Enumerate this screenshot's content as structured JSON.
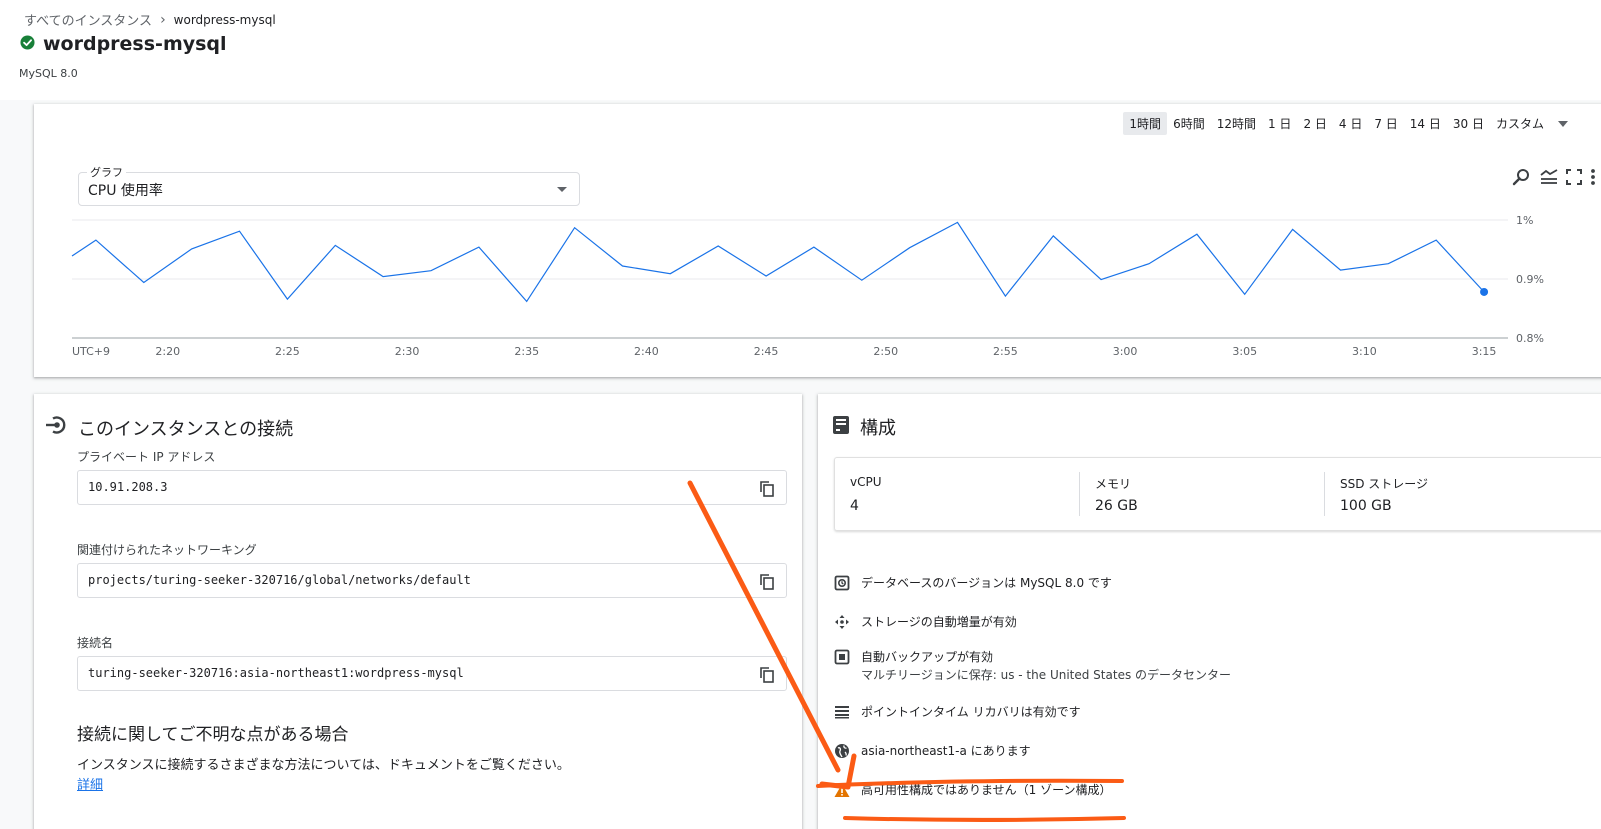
{
  "breadcrumb": {
    "parent": "すべてのインスタンス",
    "separator": "›",
    "current": "wordpress-mysql"
  },
  "instance": {
    "name": "wordpress-mysql",
    "version": "MySQL 8.0",
    "status": "running"
  },
  "timeRange": {
    "options": [
      "1時間",
      "6時間",
      "12時間",
      "1 日",
      "2 日",
      "4 日",
      "7 日",
      "14 日",
      "30 日",
      "カスタム"
    ],
    "selected": "1時間"
  },
  "chartSelector": {
    "label": "グラフ",
    "value": "CPU 使用率"
  },
  "chart_data": {
    "type": "line",
    "timezone": "UTC+9",
    "xticks": [
      "2:20",
      "2:25",
      "2:30",
      "2:35",
      "2:40",
      "2:45",
      "2:50",
      "2:55",
      "3:00",
      "3:05",
      "3:10",
      "3:15"
    ],
    "yticks": [
      "1%",
      "0.9%",
      "0.8%"
    ],
    "ylim": [
      0.8,
      1.0
    ],
    "grid": true,
    "series": [
      {
        "color": "#1a73e8",
        "x": [
          "2:16",
          "2:17",
          "2:19",
          "2:21",
          "2:23",
          "2:25",
          "2:27",
          "2:29",
          "2:31",
          "2:33",
          "2:35",
          "2:37",
          "2:39",
          "2:41",
          "2:43",
          "2:45",
          "2:47",
          "2:49",
          "2:51",
          "2:53",
          "2:55",
          "2:57",
          "2:59",
          "3:01",
          "3:03",
          "3:05",
          "3:07",
          "3:09",
          "3:11",
          "3:13",
          "3:15"
        ],
        "values": [
          0.939,
          0.966,
          0.894,
          0.951,
          0.981,
          0.866,
          0.957,
          0.904,
          0.914,
          0.954,
          0.862,
          0.987,
          0.922,
          0.909,
          0.956,
          0.905,
          0.954,
          0.898,
          0.953,
          0.996,
          0.871,
          0.973,
          0.899,
          0.926,
          0.976,
          0.874,
          0.984,
          0.915,
          0.926,
          0.966,
          0.878
        ]
      }
    ]
  },
  "connection": {
    "title": "このインスタンスとの接続",
    "private_ip_label": "プライベート IP アドレス",
    "private_ip": "10.91.208.3",
    "network_label": "関連付けられたネットワーキング",
    "network": "projects/turing-seeker-320716/global/networks/default",
    "conn_name_label": "接続名",
    "conn_name": "turing-seeker-320716:asia-northeast1:wordpress-mysql",
    "help_title": "接続に関してご不明な点がある場合",
    "help_text": "インスタンスに接続するさまざまな方法については、ドキュメントをご覧ください。",
    "help_link": "詳細"
  },
  "config": {
    "title": "構成",
    "specs": [
      {
        "label": "vCPU",
        "value": "4"
      },
      {
        "label": "メモリ",
        "value": "26 GB"
      },
      {
        "label": "SSD ストレージ",
        "value": "100 GB"
      }
    ],
    "items": [
      {
        "icon": "database-version-icon",
        "text": "データベースのバージョンは MySQL 8.0 です"
      },
      {
        "icon": "storage-increase-icon",
        "text": "ストレージの自動増量が有効"
      },
      {
        "icon": "backup-icon",
        "text": "自動バックアップが有効",
        "sub": "マルチリージョンに保存: us - the United States のデータセンター"
      },
      {
        "icon": "list-icon",
        "text": "ポイントインタイム リカバリは有効です"
      },
      {
        "icon": "globe-icon",
        "text": "asia-northeast1-a にあります"
      },
      {
        "icon": "warning-icon",
        "text": "高可用性構成ではありません（1 ゾーン構成）"
      }
    ]
  },
  "colors": {
    "accent": "#1a73e8",
    "success": "#188038",
    "warning": "#e37400",
    "annotation": "#fb5b15"
  }
}
